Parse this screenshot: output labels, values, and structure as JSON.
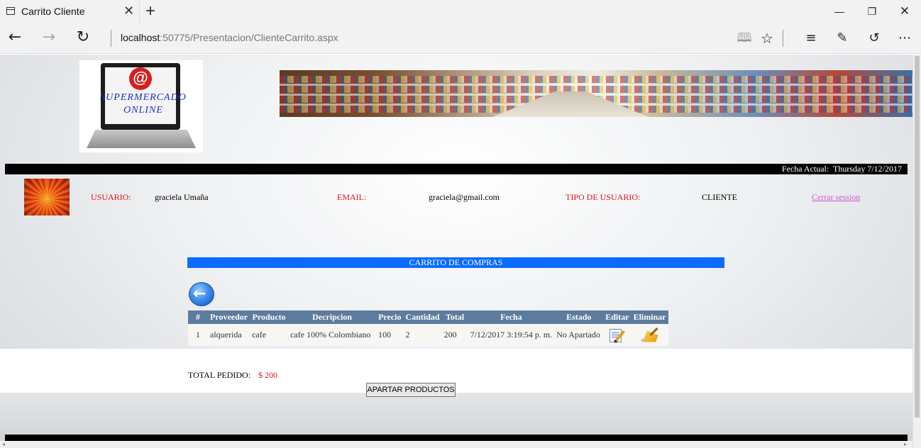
{
  "browser": {
    "tab_title": "Carrito Cliente",
    "tab_close": "✕",
    "new_tab": "+",
    "address_host": "localhost",
    "address_rest": ":50775/Presentacion/ClienteCarrito.aspx",
    "icons": [
      "back-icon",
      "forward-icon",
      "refresh-icon",
      "reading-view-icon",
      "favorite-star-icon",
      "hub-icon",
      "web-note-icon",
      "share-icon",
      "more-icon"
    ]
  },
  "header": {
    "logo_line1": "SUPERMERCADO",
    "logo_line2": "ONLINE",
    "logo_at": "@",
    "date_label": "Fecha Actual:",
    "date_value": "Thursday 7/12/2017"
  },
  "user": {
    "usuario_label": "USUARIO:",
    "usuario_value": "graciela Umaña",
    "email_label": "EMAIL:",
    "email_value": "graciela@gmail.com",
    "tipo_label": "TIPO DE USUARIO:",
    "tipo_value": "CLIENTE",
    "logout": "Cerrar session"
  },
  "cart": {
    "title": "CARRITO DE COMPRAS",
    "columns": [
      "#",
      "Proveedor",
      "Producto",
      "Decripcion",
      "Precio",
      "Cantidad",
      "Total",
      "Fecha",
      "Estado",
      "Editar",
      "Eliminar"
    ],
    "rows": [
      {
        "num": "1",
        "proveedor": "alquerida",
        "producto": "cafe",
        "descripcion": "cafe 100% Colombiano",
        "precio": "100",
        "cantidad": "2",
        "total": "200",
        "fecha": "7/12/2017 3:19:54 p. m.",
        "estado": "No Apartado"
      }
    ],
    "total_label": "TOTAL PEDIDO:",
    "total_value": "$ 200",
    "apartar_button": "APARTAR PRODUCTOS"
  },
  "colors": {
    "label_red": "#e0121c",
    "cart_header_blue": "#0a6cff",
    "table_header": "#5d7b9d",
    "logout_link": "#d05ad0"
  }
}
